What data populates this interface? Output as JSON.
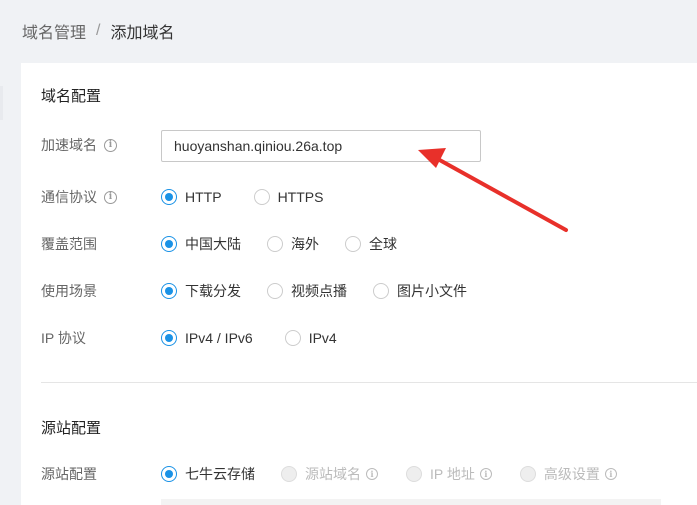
{
  "breadcrumb": {
    "parent": "域名管理",
    "separator": "/",
    "current": "添加域名"
  },
  "domain_config": {
    "title": "域名配置",
    "accel_domain": {
      "label": "加速域名",
      "value": "huoyanshan.qiniou.26a.top"
    },
    "protocol": {
      "label": "通信协议",
      "options": [
        "HTTP",
        "HTTPS"
      ],
      "selected": "HTTP"
    },
    "coverage": {
      "label": "覆盖范围",
      "options": [
        "中国大陆",
        "海外",
        "全球"
      ],
      "selected": "中国大陆"
    },
    "scenario": {
      "label": "使用场景",
      "options": [
        "下载分发",
        "视频点播",
        "图片小文件"
      ],
      "selected": "下载分发"
    },
    "ip_protocol": {
      "label": "IP 协议",
      "options": [
        "IPv4 / IPv6",
        "IPv4"
      ],
      "selected": "IPv4 / IPv6"
    }
  },
  "origin_config": {
    "title": "源站配置",
    "origin": {
      "label": "源站配置",
      "options": [
        "七牛云存储",
        "源站域名",
        "IP 地址",
        "高级设置"
      ],
      "selected": "七牛云存储"
    }
  },
  "colors": {
    "accent": "#1a92e6",
    "annotation_arrow": "#e8302a"
  },
  "icons": {
    "info": "info-circle-icon",
    "annotation": "red-arrow-icon"
  }
}
